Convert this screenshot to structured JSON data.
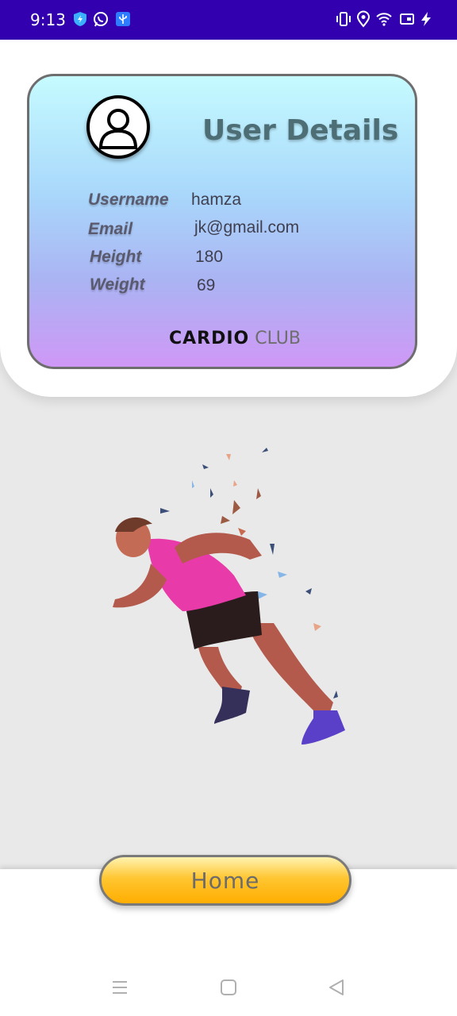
{
  "status_bar": {
    "time": "9:13"
  },
  "card": {
    "title": "User Details",
    "fields": [
      {
        "label": "Username",
        "value": "hamza"
      },
      {
        "label": "Email",
        "value": "jk@gmail.com"
      },
      {
        "label": "Height",
        "value": "180"
      },
      {
        "label": "Weight",
        "value": "69"
      }
    ],
    "brand_bold": "CARDIO",
    "brand_light": "CLUB"
  },
  "home_button": {
    "label": "Home"
  },
  "colors": {
    "status_bar": "#3300b0",
    "button": "#ffae00",
    "card_top": "#c6fbff",
    "card_bottom": "#cf98f6"
  }
}
